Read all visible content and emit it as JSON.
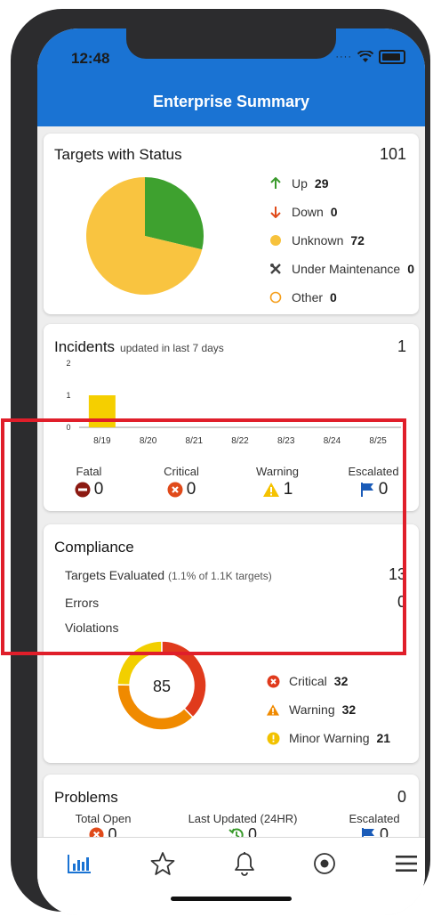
{
  "status_bar": {
    "time": "12:48"
  },
  "header": {
    "title": "Enterprise Summary"
  },
  "targets": {
    "title": "Targets with Status",
    "count": "101",
    "legend": [
      {
        "label": "Up",
        "value": "29",
        "icon": "arrow-up-icon",
        "color": "#3a9a2c"
      },
      {
        "label": "Down",
        "value": "0",
        "icon": "arrow-down-icon",
        "color": "#e04a1a"
      },
      {
        "label": "Unknown",
        "value": "72",
        "icon": "circle-filled-icon",
        "color": "#f7c23c"
      },
      {
        "label": "Under Maintenance",
        "value": "0",
        "icon": "tools-icon",
        "color": "#444444"
      },
      {
        "label": "Other",
        "value": "0",
        "icon": "circle-outline-icon",
        "color": "#f59e1b"
      }
    ],
    "pie": [
      {
        "label": "Up",
        "value": 29,
        "color": "#3ea12f"
      },
      {
        "label": "Unknown",
        "value": 72,
        "color": "#f9c440"
      }
    ]
  },
  "incidents": {
    "title": "Incidents",
    "subtitle": "updated in last 7 days",
    "count": "1",
    "chart_data": {
      "type": "bar",
      "categories": [
        "8/19",
        "8/20",
        "8/21",
        "8/22",
        "8/23",
        "8/24",
        "8/25"
      ],
      "values": [
        1,
        0,
        0,
        0,
        0,
        0,
        0
      ],
      "ylim": [
        0,
        2
      ],
      "yticks": [
        "0",
        "1",
        "2"
      ],
      "color": "#f5cf00"
    },
    "stats": [
      {
        "label": "Fatal",
        "value": "0",
        "icon": "fatal-icon",
        "color": "#8c1a12"
      },
      {
        "label": "Critical",
        "value": "0",
        "icon": "critical-icon",
        "color": "#e04a1a"
      },
      {
        "label": "Warning",
        "value": "1",
        "icon": "warning-icon",
        "color": "#f5c200"
      },
      {
        "label": "Escalated",
        "value": "0",
        "icon": "flag-icon",
        "color": "#1a5bb8"
      }
    ]
  },
  "compliance": {
    "title": "Compliance",
    "targets_evaluated_label": "Targets Evaluated",
    "targets_evaluated_sub": "(1.1% of 1.1K targets)",
    "targets_evaluated_value": "13",
    "errors_label": "Errors",
    "errors_value": "0",
    "violations_label": "Violations",
    "donut_center": "85",
    "donut": [
      {
        "label": "Critical",
        "value": 32,
        "color": "#e03a1c"
      },
      {
        "label": "Warning",
        "value": 32,
        "color": "#f08a00"
      },
      {
        "label": "Minor Warning",
        "value": 21,
        "color": "#f2cf00"
      }
    ],
    "legend": [
      {
        "label": "Critical",
        "value": "32",
        "icon": "critical-icon",
        "color": "#e03a1c"
      },
      {
        "label": "Warning",
        "value": "32",
        "icon": "warning-icon",
        "color": "#f08a00"
      },
      {
        "label": "Minor Warning",
        "value": "21",
        "icon": "info-icon",
        "color": "#f2c200"
      }
    ]
  },
  "problems": {
    "title": "Problems",
    "count": "0",
    "stats": [
      {
        "label": "Total Open",
        "value": "0",
        "icon": "critical-icon"
      },
      {
        "label": "Last Updated (24HR)",
        "value": "0",
        "icon": "history-icon"
      },
      {
        "label": "Escalated",
        "value": "0",
        "icon": "flag-icon"
      }
    ]
  },
  "tabbar": {
    "items": [
      {
        "icon": "bar-chart-icon",
        "active": true
      },
      {
        "icon": "star-icon",
        "active": false
      },
      {
        "icon": "bell-icon",
        "active": false
      },
      {
        "icon": "target-icon",
        "active": false
      },
      {
        "icon": "menu-icon",
        "active": false
      }
    ]
  }
}
